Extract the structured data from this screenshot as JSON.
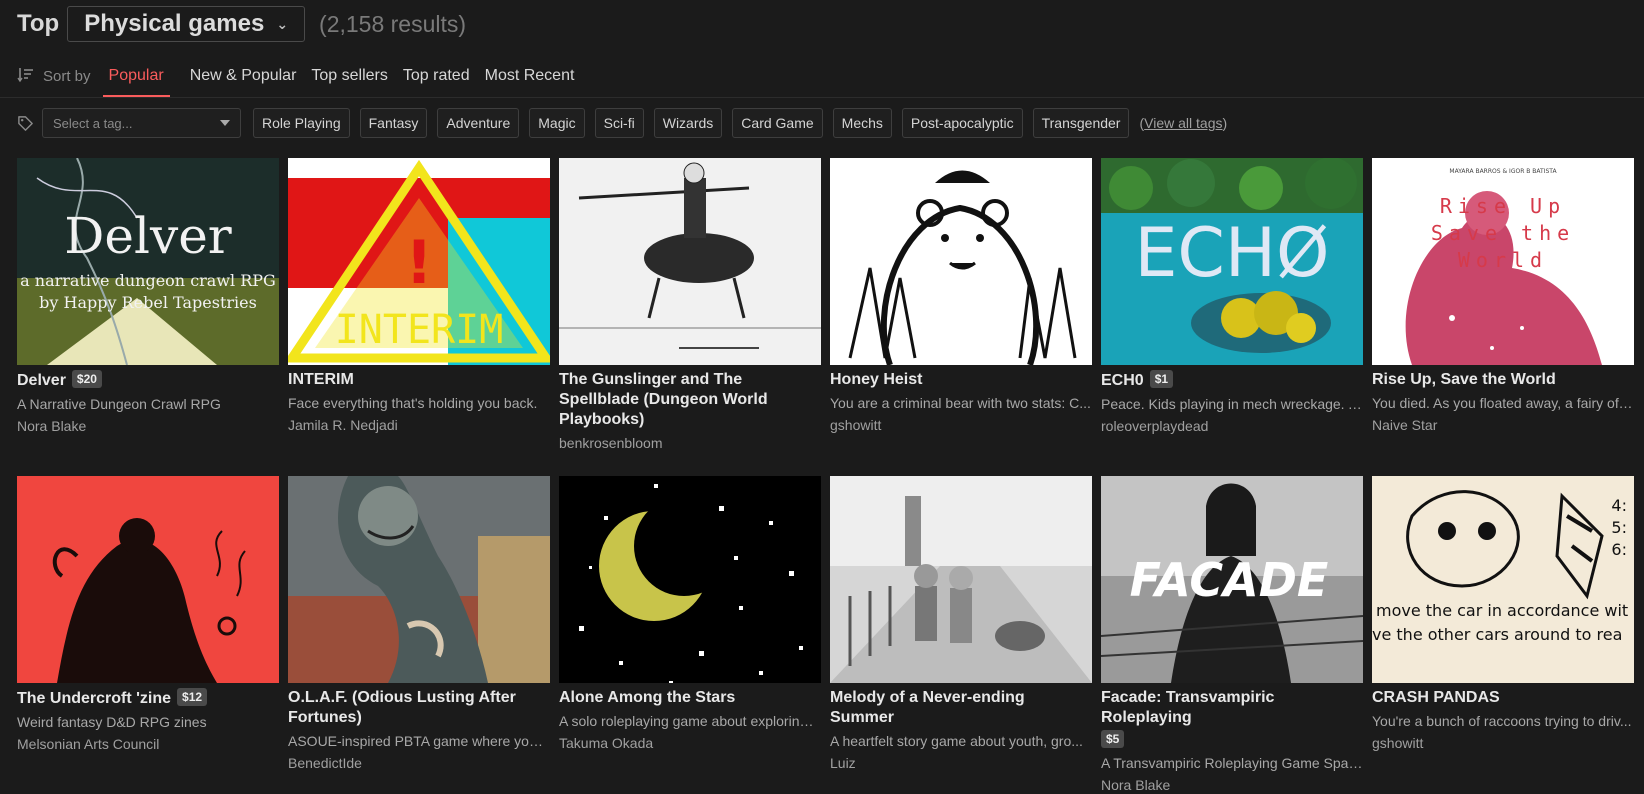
{
  "header": {
    "top_label": "Top",
    "category": "Physical games",
    "results": "(2,158 results)"
  },
  "sort": {
    "label": "Sort by",
    "tabs": [
      "Popular",
      "New & Popular",
      "Top sellers",
      "Top rated",
      "Most Recent"
    ],
    "active": "Popular"
  },
  "tags": {
    "placeholder": "Select a tag...",
    "items": [
      "Role Playing",
      "Fantasy",
      "Adventure",
      "Magic",
      "Sci-fi",
      "Wizards",
      "Card Game",
      "Mechs",
      "Post-apocalyptic",
      "Transgender"
    ],
    "view_all_open": "(",
    "view_all": "View all tags",
    "view_all_close": ")"
  },
  "games": [
    {
      "title": "Delver",
      "price": "$20",
      "desc": "A Narrative Dungeon Crawl RPG",
      "author": "Nora Blake"
    },
    {
      "title": "INTERIM",
      "price": "",
      "desc": "Face everything that's holding you back.",
      "author": "Jamila R. Nedjadi"
    },
    {
      "title": "The Gunslinger and The Spellblade (Dungeon World Playbooks)",
      "price": "",
      "desc": "",
      "author": "benkrosenbloom"
    },
    {
      "title": "Honey Heist",
      "price": "",
      "desc": "You are a criminal bear with two stats: C...",
      "author": "gshowitt"
    },
    {
      "title": "ECH0",
      "price": "$1",
      "desc": "Peace. Kids playing in mech wreckage. A ...",
      "author": "roleoverplaydead"
    },
    {
      "title": "Rise Up, Save the World",
      "price": "",
      "desc": "You died. As you floated away, a fairy off...",
      "author": "Naive Star"
    },
    {
      "title": "The Undercroft 'zine",
      "price": "$12",
      "desc": "Weird fantasy D&D RPG zines",
      "author": "Melsonian Arts Council"
    },
    {
      "title": "O.L.A.F. (Odious Lusting After Fortunes)",
      "price": "",
      "desc": "ASOUE-inspired PBTA game where you ...",
      "author": "BenedictIde"
    },
    {
      "title": "Alone Among the Stars",
      "price": "",
      "desc": "A solo roleplaying game about exploring ...",
      "author": "Takuma Okada"
    },
    {
      "title": "Melody of a Never-ending Summer",
      "price": "",
      "desc": "A heartfelt story game about youth, gro...",
      "author": "Luiz"
    },
    {
      "title": "Facade: Transvampiric Roleplaying",
      "price": "$5",
      "desc": "A Transvampiric Roleplaying Game Spark...",
      "author": "Nora Blake"
    },
    {
      "title": "CRASH PANDAS",
      "price": "",
      "desc": "You're a bunch of raccoons trying to driv...",
      "author": "gshowitt"
    }
  ],
  "cover_text": {
    "delver_title": "Delver",
    "delver_sub1": "a narrative dungeon crawl RPG",
    "delver_sub2": "by Happy Rebel Tapestries",
    "interim_bang": "!",
    "interim_word": "INTERIM",
    "echo_word": "ECHØ",
    "rise_authors": "MAYARA BARROS & IGOR B BATISTA",
    "rise_l1": "Rise Up",
    "rise_l2": "Save the",
    "rise_l3": "World",
    "facade_word": "FACADE",
    "crash_l1": "move the car in accordance wit",
    "crash_l2": "ve the other cars around to rea",
    "crash_n1": "4:",
    "crash_n2": "5:",
    "crash_n3": "6:"
  },
  "colors": {
    "accent": "#fa5c5c",
    "background": "#1b1b1b"
  }
}
